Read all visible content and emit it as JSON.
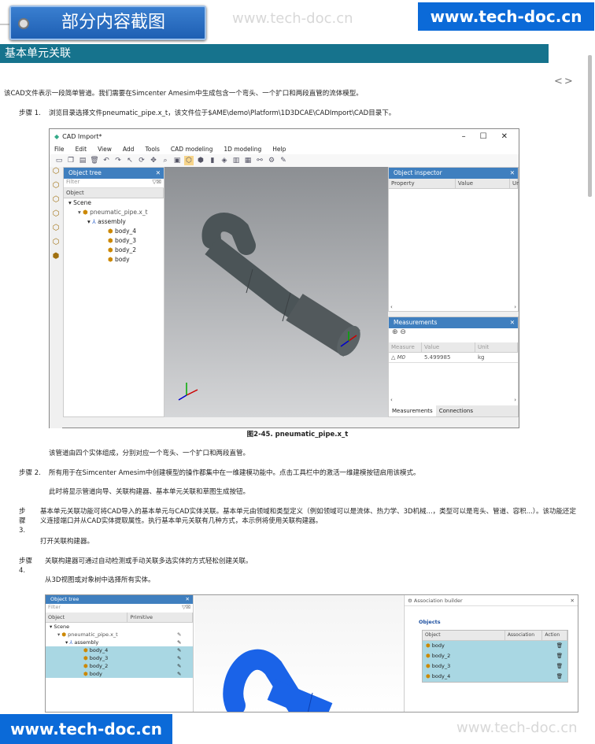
{
  "header": {
    "badge_text": "部分内容截图",
    "watermark_top": "www.tech-doc.cn",
    "url_top": "www.tech-doc.cn",
    "url_bottom": "www.tech-doc.cn",
    "watermark_bottom": "www.tech-doc.cn"
  },
  "section_title": "基本单元关联",
  "nav": {
    "prev": "<",
    "next": ">"
  },
  "intro": "该CAD文件表示一段简单管道。我们需要在Simcenter Amesim中生成包含一个弯头、一个扩口和两段直管的流体模型。",
  "steps": {
    "s1_label": "步骤 1.",
    "s1_text": "浏览目录选择文件pneumatic_pipe.x_t，该文件位于$AME\\demo\\Platform\\1D3DCAE\\CADImport\\CAD目录下。",
    "s1_note": "该管道由四个实体组成，分别对应一个弯头、一个扩口和两段直管。",
    "s2_label": "步骤 2.",
    "s2_text": "所有用于在Simcenter Amesim中创建模型的操作都集中在一维建模功能中。点击工具栏中的激活一维建模按钮启用该模式。",
    "s2_note": "此时将显示管道向导、关联构建器、基本单元关联和草图生成按钮。",
    "s3_label": "步骤 3.",
    "s3_text": "基本单元关联功能可将CAD导入的基本单元与CAD实体关联。基本单元由领域和类型定义（例如领域可以是流体、热力学、3D机械...，类型可以是弯头、管道、容积...）。该功能还定义连接端口并从CAD实体提取属性。执行基本单元关联有几种方式，本示例将使用关联构建器。",
    "s3_note": "打开关联构建器。",
    "s4_label": "步骤 4.",
    "s4_text": "关联构建器可通过自动检测或手动关联多选实体的方式轻松创建关联。",
    "s4_note": "从3D视图或对象树中选择所有实体。"
  },
  "figure_caption": "图2-45. pneumatic_pipe.x_t",
  "cad_window": {
    "title": "CAD Import*",
    "menus": [
      "File",
      "Edit",
      "View",
      "Add",
      "Tools",
      "CAD modeling",
      "1D modeling",
      "Help"
    ],
    "object_tree": {
      "title": "Object tree",
      "filter_placeholder": "Filter",
      "column": "Object",
      "rows": [
        "Scene",
        "pneumatic_pipe.x_t",
        "assembly",
        "body_4",
        "body_3",
        "body_2",
        "body"
      ]
    },
    "object_inspector": {
      "title": "Object inspector",
      "columns": [
        "Property",
        "Value",
        "Ur"
      ]
    },
    "measurements": {
      "title": "Measurements",
      "columns": [
        "Measure",
        "Value",
        "Unit"
      ],
      "row": {
        "measure": "M0",
        "value": "5.499985",
        "unit": "kg"
      },
      "tabs": [
        "Measurements",
        "Connections"
      ]
    }
  },
  "shot2": {
    "tree_title": "Object tree",
    "filter_placeholder": "Filter",
    "columns": [
      "Object",
      "Primitive"
    ],
    "rows": [
      "Scene",
      "pneumatic_pipe.x_t",
      "assembly",
      "body_4",
      "body_3",
      "body_2",
      "body"
    ],
    "assoc_title": "Association builder",
    "objects_label": "Objects",
    "assoc_columns": [
      "Object",
      "Association",
      "Action"
    ],
    "assoc_rows": [
      "body",
      "body_2",
      "body_3",
      "body_4"
    ]
  },
  "colors": {
    "section": "#16738d",
    "url": "#0b6ad8",
    "panel": "#3f7fbf"
  }
}
